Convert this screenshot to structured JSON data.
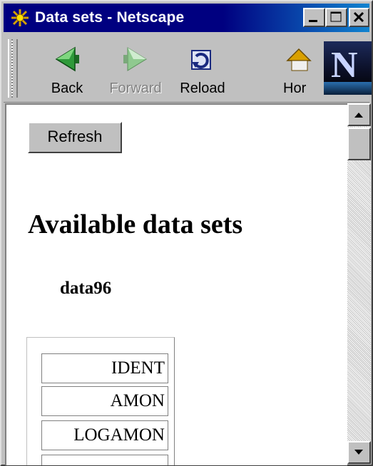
{
  "window": {
    "title": "Data sets - Netscape",
    "controls": {
      "minimize_icon": "minimize-icon",
      "maximize_icon": "maximize-icon",
      "close_icon": "close-icon"
    }
  },
  "toolbar": {
    "back_label": "Back",
    "forward_label": "Forward",
    "reload_label": "Reload",
    "home_label": "Hor",
    "logo_letter": "N"
  },
  "content": {
    "refresh_label": "Refresh",
    "heading": "Available data sets",
    "dataset_name": "data96",
    "variables": [
      "IDENT",
      "AMON",
      "LOGAMON",
      ""
    ]
  },
  "colors": {
    "titlebar": "#000080",
    "chrome": "#c0c0c0",
    "page_bg": "#ffffff"
  }
}
